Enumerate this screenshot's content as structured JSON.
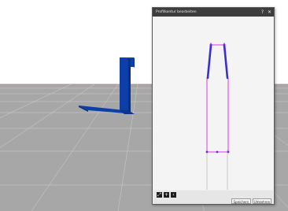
{
  "dialog": {
    "title": "Profilkontur bearbeiten",
    "help_label": "?",
    "close_label": "✕",
    "tools": {
      "fit_icon": "fit-view-icon",
      "add_icon": "add-point-icon",
      "back_icon": "back-icon"
    },
    "save_label": "Speichern",
    "undo_label": "Umkehren"
  },
  "colors": {
    "profile_line": "#e535e0",
    "profile_handle": "#3a2fd0",
    "model_blue": "#0c3fa8",
    "floor": "#a7a7a7",
    "grid": "#cfcfcf",
    "horizon": "#b08d7f"
  }
}
